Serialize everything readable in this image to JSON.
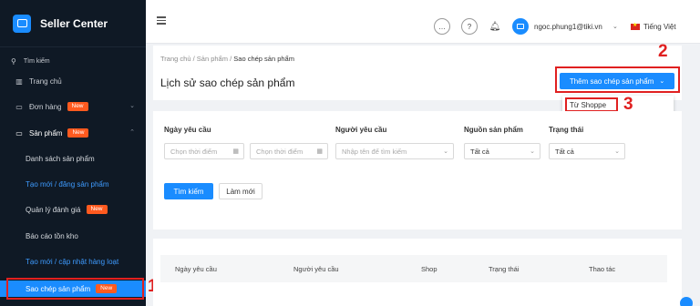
{
  "sidebar": {
    "app_title": "Seller Center",
    "search_label": "Tìm kiếm",
    "items": [
      {
        "label": "Trang chủ"
      },
      {
        "label": "Đơn hàng",
        "badge": "New"
      },
      {
        "label": "Sản phẩm",
        "badge": "New"
      }
    ],
    "sub_items": [
      {
        "label": "Danh sách sản phẩm"
      },
      {
        "label": "Tạo mới / đăng sản phẩm"
      },
      {
        "label": "Quản lý đánh giá",
        "badge": "New"
      },
      {
        "label": "Báo cáo tồn kho"
      },
      {
        "label": "Tạo mới / cập nhật hàng loạt"
      },
      {
        "label": "Sao chép sản phẩm",
        "badge": "New"
      }
    ]
  },
  "topbar": {
    "user_email": "ngoc.phung1@tiki.vn",
    "language": "Tiếng Việt"
  },
  "breadcrumb": {
    "items": [
      "Trang chủ",
      "Sản phẩm",
      "Sao chép sản phẩm"
    ],
    "sep": "/"
  },
  "page": {
    "title": "Lịch sử sao chép sản phẩm",
    "add_button": "Thêm sao chép sản phẩm",
    "dropdown_item": "Từ Shoppe"
  },
  "filters": {
    "request_date_label": "Ngày yêu cầu",
    "date_from_placeholder": "Chọn thời điểm",
    "date_to_placeholder": "Chọn thời điểm",
    "requester_label": "Người yêu cầu",
    "requester_placeholder": "Nhập tên để tìm kiếm",
    "source_label": "Nguồn sản phẩm",
    "source_value": "Tất cả",
    "status_label": "Trạng thái",
    "status_value": "Tất cả",
    "search_button": "Tìm kiếm",
    "reset_button": "Làm mới"
  },
  "table": {
    "columns": [
      "Ngày yêu cầu",
      "Người yêu cầu",
      "Shop",
      "Trạng thái",
      "Thao tác"
    ]
  },
  "annotations": {
    "step1": "1",
    "step2": "2",
    "step3": "3"
  },
  "colors": {
    "sidebar_bg": "#0f1925",
    "primary": "#1a8cff",
    "badge": "#ff5a1f",
    "highlight": "#e02020"
  }
}
